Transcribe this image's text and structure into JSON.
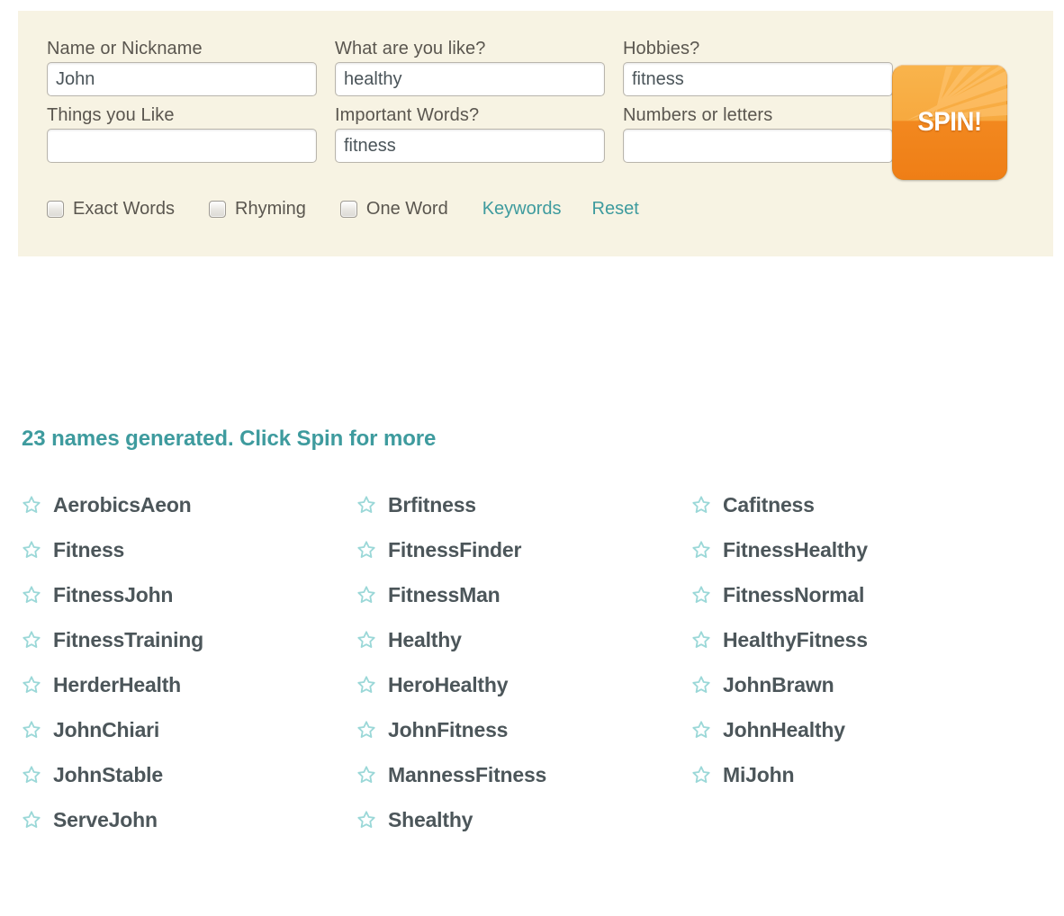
{
  "form": {
    "fields": [
      {
        "label": "Name or Nickname",
        "value": "John",
        "placeholder": "",
        "name": "name-or-nickname"
      },
      {
        "label": "What are you like?",
        "value": "healthy",
        "placeholder": "",
        "name": "what-are-you-like"
      },
      {
        "label": "Hobbies?",
        "value": "fitness",
        "placeholder": "",
        "name": "hobbies"
      },
      {
        "label": "Things you Like",
        "value": "",
        "placeholder": "",
        "name": "things-you-like"
      },
      {
        "label": "Important Words?",
        "value": "fitness",
        "placeholder": "",
        "name": "important-words"
      },
      {
        "label": "Numbers or letters",
        "value": "",
        "placeholder": "",
        "name": "numbers-or-letters"
      }
    ],
    "spin_button_label": "SPIN!",
    "checkboxes": [
      {
        "label": "Exact Words",
        "checked": false
      },
      {
        "label": "Rhyming",
        "checked": false
      },
      {
        "label": "One Word",
        "checked": false
      }
    ],
    "links": [
      {
        "label": "Keywords"
      },
      {
        "label": "Reset"
      }
    ]
  },
  "results": {
    "heading": "23 names generated. Click Spin for more",
    "count": 23,
    "star_icon": "star-outline-icon",
    "names": [
      "AerobicsAeon",
      "Fitness",
      "FitnessJohn",
      "FitnessTraining",
      "HerderHealth",
      "JohnChiari",
      "JohnStable",
      "ServeJohn",
      "Brfitness",
      "FitnessFinder",
      "FitnessMan",
      "Healthy",
      "HeroHealthy",
      "JohnFitness",
      "MannessFitness",
      "Shealthy",
      "Cafitness",
      "FitnessHealthy",
      "FitnessNormal",
      "HealthyFitness",
      "JohnBrawn",
      "JohnHealthy",
      "MiJohn"
    ]
  },
  "colors": {
    "panel_background": "#f7f3e3",
    "accent_teal": "#3e9b9e",
    "star_teal": "#9bd8d8",
    "name_text": "#4c565a",
    "label_text": "#5a564f",
    "spin_orange_top": "#f9b44c",
    "spin_orange_bottom": "#ef7e16"
  }
}
